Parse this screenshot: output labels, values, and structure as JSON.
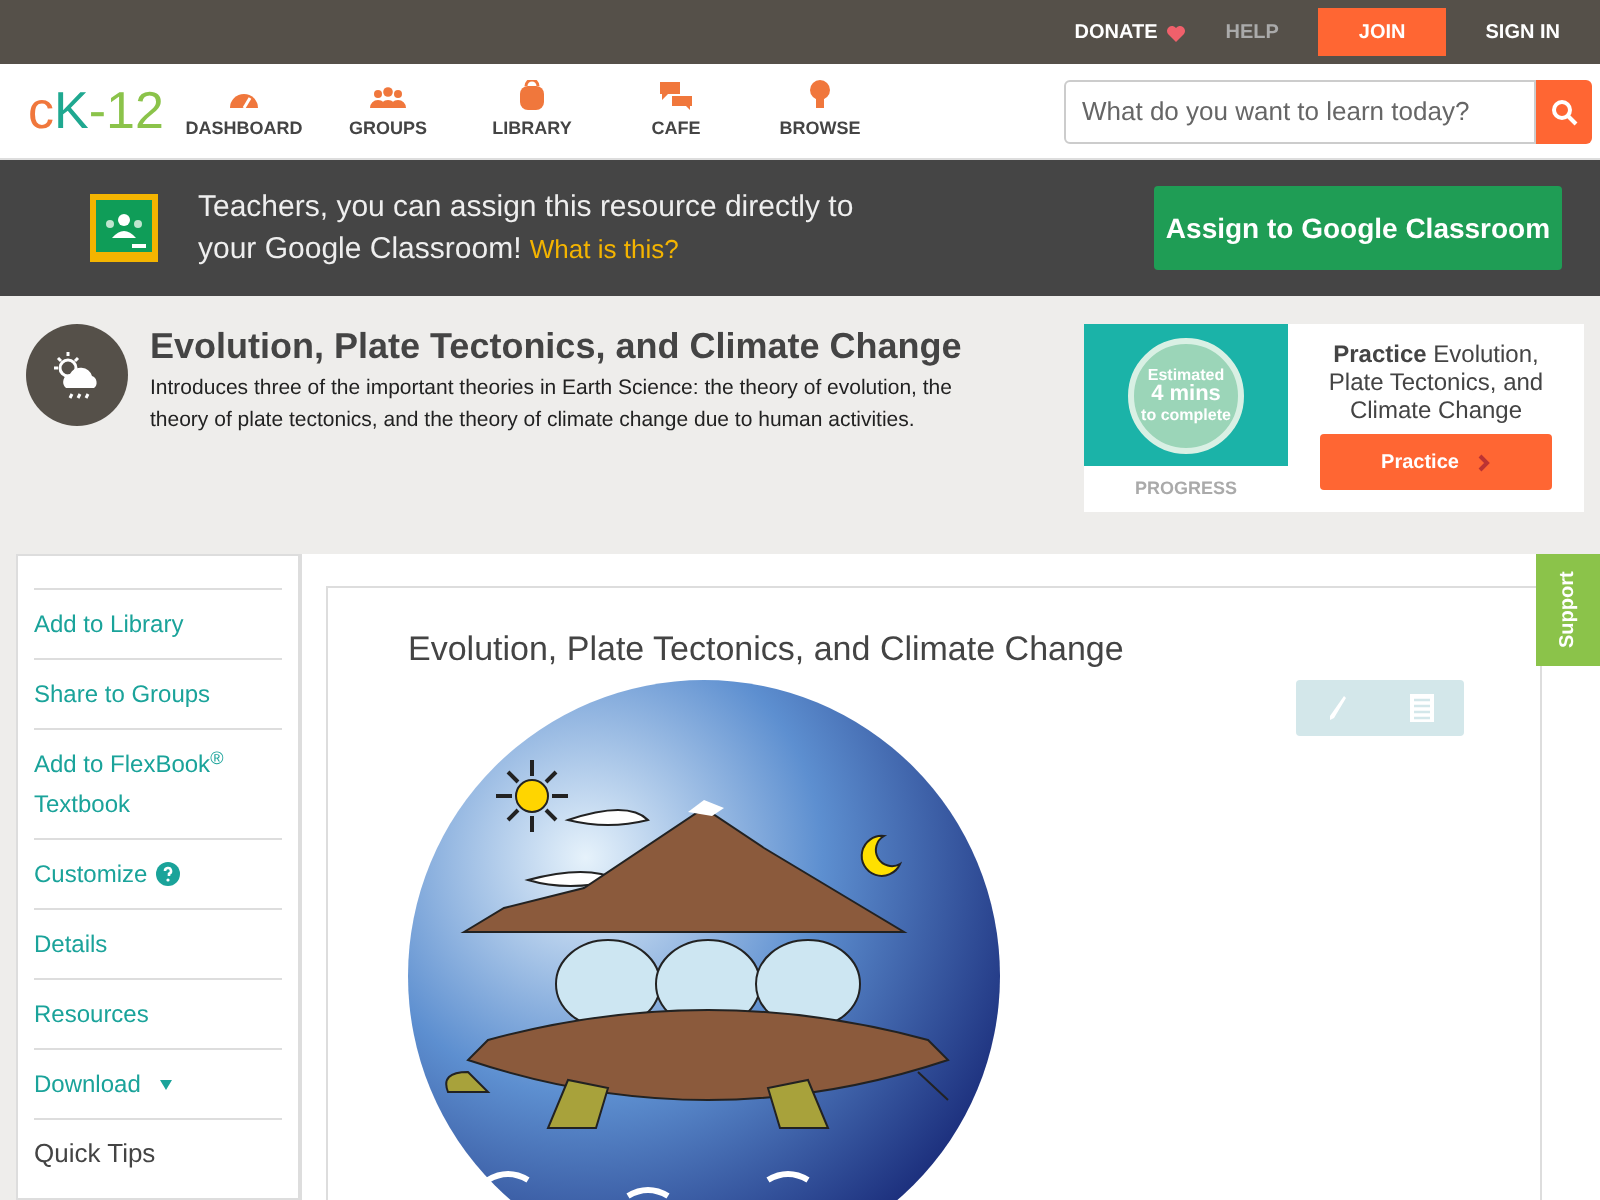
{
  "top_bar": [
    {
      "label": "DONATE",
      "kind": "donate"
    },
    {
      "label": "HELP",
      "kind": "muted"
    },
    {
      "label": "JOIN",
      "kind": "primary"
    },
    {
      "label": "SIGN IN",
      "kind": "plain"
    }
  ],
  "logo": {
    "text": "cK-12"
  },
  "nav": [
    {
      "label": "DASHBOARD"
    },
    {
      "label": "GROUPS"
    },
    {
      "label": "LIBRARY"
    },
    {
      "label": "CAFE"
    },
    {
      "label": "BROWSE"
    }
  ],
  "search": {
    "placeholder": "What do you want to learn today?"
  },
  "banner": {
    "text": "Teachers, you can assign this resource directly to your Google Classroom!",
    "link": "What is this?",
    "button": "Assign to Google Classroom"
  },
  "header": {
    "title": "Evolution, Plate Tectonics, and Climate Change",
    "description": "Introduces three of the important theories in Earth Science: the theory of evolution, the theory of plate tectonics, and the theory of climate change due to human activities."
  },
  "practice": {
    "estimate": [
      "Estimated",
      "4 mins",
      "to complete"
    ],
    "progress": "PROGRESS",
    "title": "**Practice** Evolution, Plate Tectonics, and Climate Change",
    "button": "Practice"
  },
  "sidebar": {
    "items": [
      {
        "label": "Add to Library",
        "kind": "link"
      },
      {
        "label": "Share to Groups",
        "kind": "link"
      },
      {
        "label": "Add to FlexBook$^{®}$ Textbook",
        "kind": "link"
      },
      {
        "label": "Customize",
        "kind": "help"
      },
      {
        "label": "Details",
        "kind": "link"
      },
      {
        "label": "Resources",
        "kind": "link"
      },
      {
        "label": "Download",
        "kind": "dropdown"
      },
      {
        "label": "Quick Tips",
        "kind": "heading"
      }
    ]
  },
  "content": {
    "title": "Evolution, Plate Tectonics, and Climate Change"
  },
  "support_tab": {
    "label": "Support"
  }
}
